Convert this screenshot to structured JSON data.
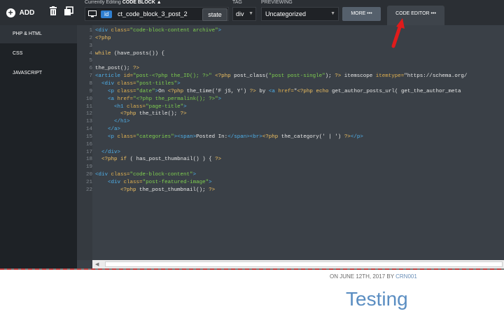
{
  "toolbar": {
    "add_label": "ADD",
    "editing_prefix": "Currently Editing",
    "editing_type": "CODE BLOCK",
    "selector_id_badge": "id",
    "selector_value": "ct_code_block_3_post_2",
    "state_label": "state",
    "tag_label": "TAG",
    "tag_value": "div",
    "previewing_label": "PREVIEWING",
    "previewing_value": "Uncategorized",
    "more_label": "MORE",
    "code_editor_tab": "CODE EDITOR"
  },
  "sidebar": {
    "items": [
      {
        "label": "PHP & HTML",
        "active": true
      },
      {
        "label": "CSS",
        "active": false
      },
      {
        "label": "JAVASCRIPT",
        "active": false
      }
    ]
  },
  "editor": {
    "line_numbers": [
      "1",
      "2",
      "3",
      "4",
      "5",
      "6",
      "7",
      "8",
      "9",
      "10",
      "11",
      "12",
      "13",
      "14",
      "15",
      "16",
      "17",
      "18",
      "19",
      "20",
      "21",
      "22"
    ],
    "lines": [
      "<div class=\"code-block-content archive\">",
      "<?php",
      "",
      "while (have_posts()) {",
      "",
      "the_post(); ?>",
      "<article id=\"post-<?php the_ID(); ?>\" <?php post_class(\"post post-single\"); ?> itemscope itemtype=\"https://schema.org/",
      "  <div class=\"post-titles\">",
      "    <p class=\"date\">On <?php the_time('F jS, Y') ?> by <a href=\"<?php echo get_author_posts_url( get_the_author_meta",
      "    <a href=\"<?php the_permalink(); ?>\">",
      "      <h1 class=\"page-title\">",
      "        <?php the_title(); ?>",
      "      </h1>",
      "    </a>",
      "    <p class=\"categories\"><span>Posted In:</span><br><?php the_category(' | ') ?></p>",
      "",
      "  </div>",
      "  <?php if ( has_post_thumbnail() ) { ?>",
      "",
      "<div class=\"code-block-content\">",
      "    <div class=\"post-featured-image\">",
      "        <?php the_post_thumbnail(); ?>"
    ]
  },
  "preview": {
    "meta_prefix": "ON JUNE 12TH, 2017 BY",
    "meta_author": "CRN001",
    "title": "Testing"
  },
  "colors": {
    "tag": "#4fb0ea",
    "attr": "#e0b050",
    "string": "#7fcf4f",
    "keyword": "#f0c060",
    "php": "#f0c060",
    "text": "#e8e8e8",
    "accent": "#2f7fd1",
    "annotation": "#e01b1b"
  }
}
